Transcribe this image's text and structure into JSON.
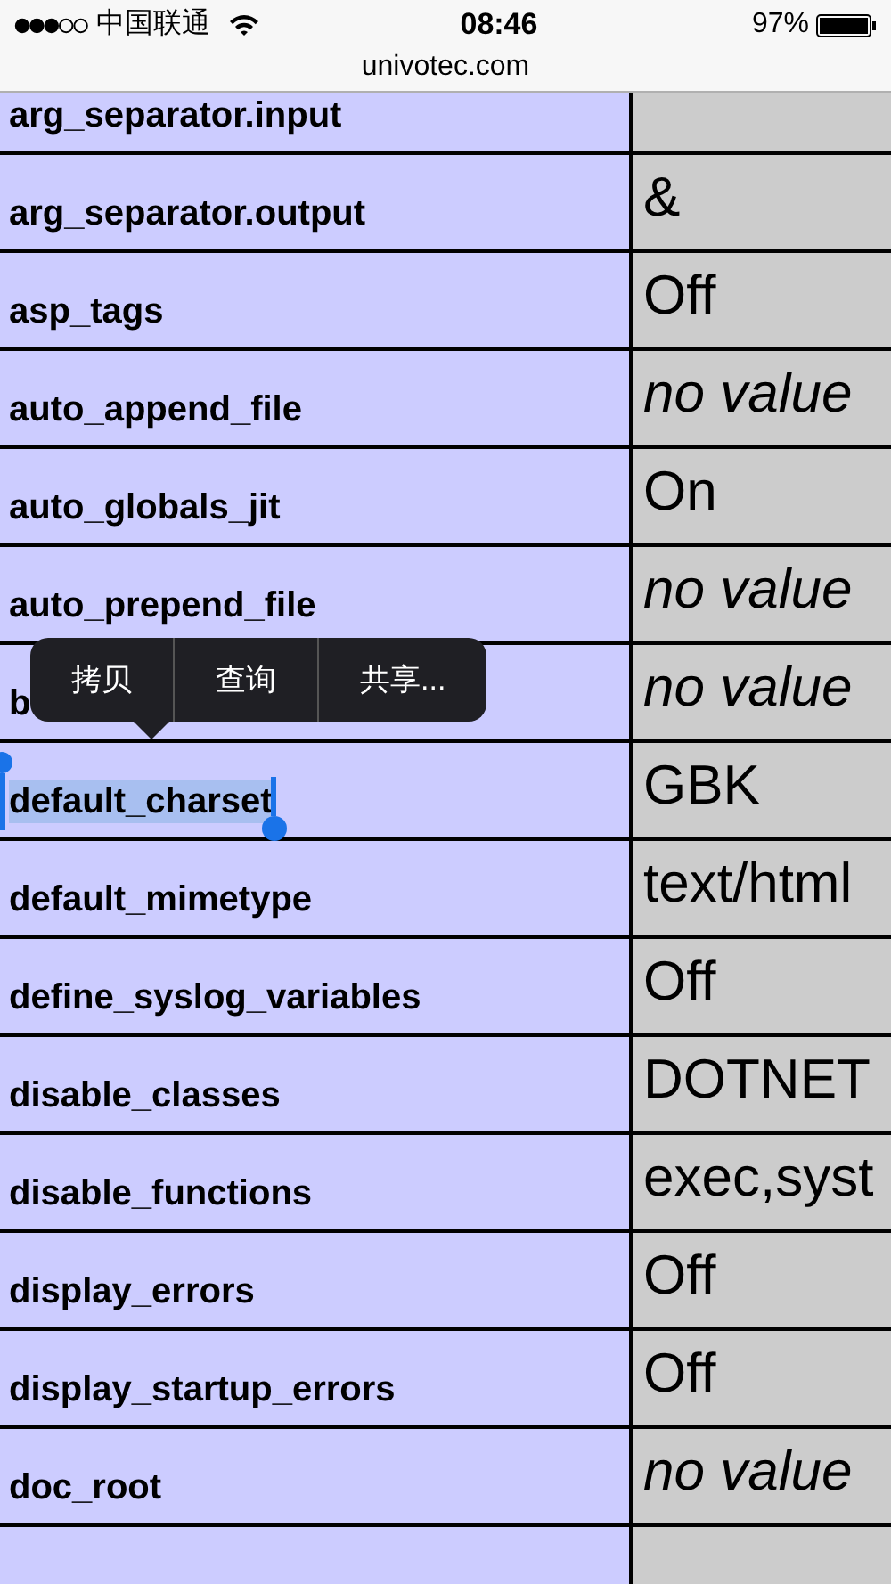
{
  "status_bar": {
    "carrier": "中国联通",
    "time": "08:46",
    "battery": "97%"
  },
  "address_bar": {
    "url": "univotec.com"
  },
  "table": {
    "rows": [
      {
        "key": "arg_separator.input",
        "selected": false
      },
      {
        "key": "arg_separator.output",
        "value": "&",
        "kind": "plain",
        "selected": false
      },
      {
        "key": "asp_tags",
        "value": "Off",
        "kind": "plain",
        "selected": false
      },
      {
        "key": "auto_append_file",
        "value": "no value",
        "kind": "none",
        "selected": false
      },
      {
        "key": "auto_globals_jit",
        "value": "On",
        "kind": "plain",
        "selected": false
      },
      {
        "key": "auto_prepend_file",
        "value": "no value",
        "kind": "none",
        "selected": false
      },
      {
        "key": "b",
        "value": "no value",
        "kind": "none",
        "selected": false
      },
      {
        "key": "default_charset",
        "value": "GBK",
        "kind": "plain",
        "selected": true
      },
      {
        "key": "default_mimetype",
        "value": "text/html",
        "kind": "plain",
        "selected": false
      },
      {
        "key": "define_syslog_variables",
        "value": "Off",
        "kind": "plain",
        "selected": false
      },
      {
        "key": "disable_classes",
        "value": "DOTNET",
        "kind": "plain",
        "selected": false
      },
      {
        "key": "disable_functions",
        "value": "exec,syst",
        "kind": "plain",
        "selected": false
      },
      {
        "key": "display_errors",
        "value": "Off",
        "kind": "plain",
        "selected": false
      },
      {
        "key": "display_startup_errors",
        "value": "Off",
        "kind": "plain",
        "selected": false
      },
      {
        "key": "doc_root",
        "value": "no value",
        "kind": "none",
        "selected": false
      }
    ]
  },
  "context_menu": {
    "items": [
      "拷贝",
      "查询",
      "共享..."
    ]
  }
}
